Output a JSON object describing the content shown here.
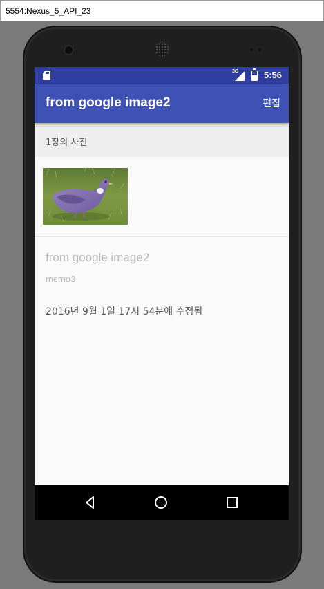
{
  "emulator": {
    "window_title": "5554:Nexus_5_API_23"
  },
  "status_bar": {
    "network": "3G",
    "time": "5:56",
    "icons": [
      "sd-card-icon",
      "signal-icon",
      "battery-icon"
    ]
  },
  "toolbar": {
    "title": "from google image2",
    "edit_label": "편집"
  },
  "photos": {
    "count_label": "1장의 사진",
    "thumbnail_icon": "pigeon-photo"
  },
  "note": {
    "title": "from google image2",
    "memo": "memo3",
    "modified": "2016년 9월 1일 17시 54분에 수정됨"
  },
  "nav_bar": {
    "icons": [
      "back-icon",
      "home-icon",
      "recents-icon"
    ]
  },
  "colors": {
    "status_bar": "#303f9f",
    "toolbar": "#3f51b5",
    "background": "#fafafa"
  }
}
